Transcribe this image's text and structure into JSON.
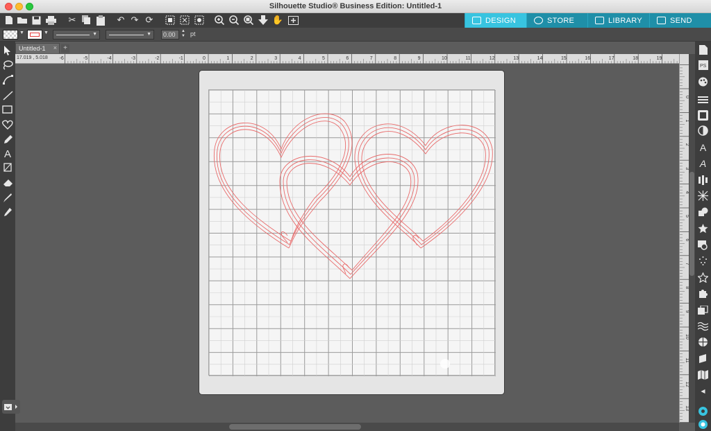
{
  "window": {
    "title": "Silhouette Studio® Business Edition: Untitled-1"
  },
  "toolbar": {
    "icons": [
      "new-file-icon",
      "open-folder-icon",
      "save-icon",
      "print-icon",
      "cut-icon",
      "copy-icon",
      "paste-icon",
      "undo-icon",
      "redo-icon",
      "rotate-icon",
      "group-icon",
      "ungroup-icon",
      "compound-icon",
      "zoom-in-icon",
      "zoom-out-icon",
      "zoom-fit-icon",
      "pan-down-icon",
      "hand-icon",
      "add-page-icon"
    ]
  },
  "tabs": [
    {
      "label": "DESIGN",
      "icon": "grid-icon",
      "active": true
    },
    {
      "label": "STORE",
      "icon": "store-icon",
      "active": false
    },
    {
      "label": "LIBRARY",
      "icon": "library-icon",
      "active": false
    },
    {
      "label": "SEND",
      "icon": "send-icon",
      "active": false
    }
  ],
  "subbar": {
    "line_width_value": "0.00",
    "line_width_unit": "pt",
    "fill_color": "#ffffff",
    "line_color": "#e23c3c"
  },
  "document": {
    "tab_label": "Untitled-1",
    "close_label": "×",
    "add_tab_label": "+",
    "cursor_coords": "17.019 , 5.018"
  },
  "ruler": {
    "h_labels": [
      "-6",
      "-5",
      "-4",
      "-3",
      "-2",
      "-1",
      "0",
      "1",
      "2",
      "3",
      "4",
      "5",
      "6",
      "7",
      "8",
      "9",
      "10",
      "11",
      "12",
      "13",
      "14",
      "15",
      "16",
      "17",
      "18",
      "19"
    ],
    "v_labels": [
      "0",
      "1",
      "2",
      "3",
      "4",
      "5",
      "6",
      "7",
      "8",
      "9",
      "10",
      "11",
      "12",
      "13"
    ]
  },
  "canvas": {
    "grid_columns": 12,
    "grid_rows": 12,
    "accent_color": "#e86a6a",
    "shapes": [
      "heart-left",
      "heart-right",
      "heart-center"
    ]
  },
  "colors": {
    "accent": "#38c4e0",
    "tab_bg": "#1f8fa8",
    "toolbar": "#3d3d3d",
    "mat": "#e5e5e5"
  }
}
